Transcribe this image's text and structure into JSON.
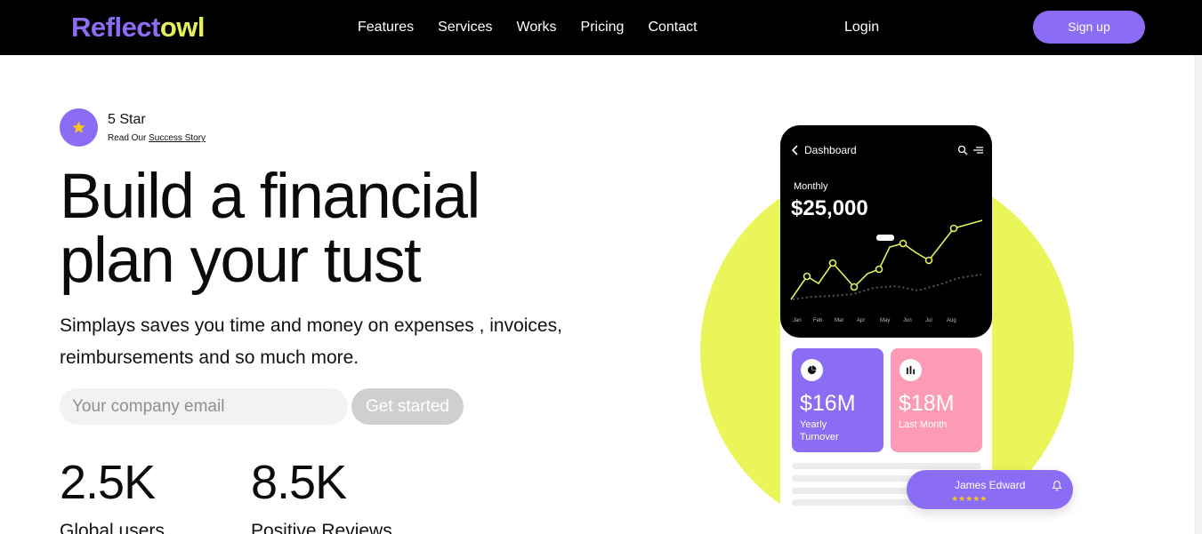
{
  "nav": {
    "logo_part1": "Reflect",
    "logo_part2": "owl",
    "links": [
      "Features",
      "Services",
      "Works",
      "Pricing",
      "Contact"
    ],
    "login": "Login",
    "signup": "Sign up"
  },
  "rating": {
    "title": "5 Star",
    "sub_prefix": "Read Our",
    "sub_link": "Success Story",
    "icon": "star-icon"
  },
  "hero": {
    "title_line1": "Build a financial",
    "title_line2": "plan your tust",
    "description": "Simplays saves you time and money on expenses , invoices, reimbursements and so much more."
  },
  "signup_form": {
    "email_placeholder": "Your company email",
    "button": "Get started"
  },
  "stats": [
    {
      "value": "2.5K",
      "label": "Global users"
    },
    {
      "value": "8.5K",
      "label": "Positive Reviews"
    }
  ],
  "phone": {
    "title": "Dashboard",
    "period": "Monthly",
    "amount": "$25,000",
    "months": [
      "Jan",
      "Feb",
      "Mar",
      "Apr",
      "May",
      "Jun",
      "Jul",
      "Aug"
    ],
    "cards": [
      {
        "value": "$16M",
        "label": "Yearly Turnover",
        "icon": "pie-chart-icon"
      },
      {
        "value": "$18M",
        "label": "Last Month",
        "icon": "bar-chart-icon"
      }
    ]
  },
  "review": {
    "name": "James Edward",
    "stars": "★★★★★"
  },
  "colors": {
    "purple": "#8b6cf4",
    "yellow": "#eaf55a",
    "pink": "#fd9ab5",
    "black": "#000000"
  }
}
